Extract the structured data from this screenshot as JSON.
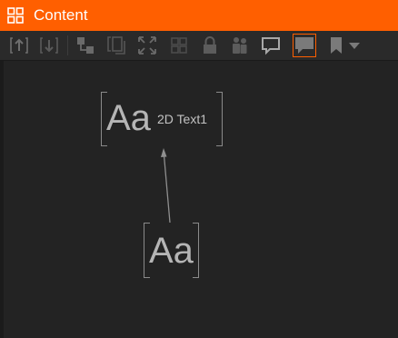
{
  "window": {
    "title": "Content",
    "accent_color": "#ff5f00"
  },
  "toolbar": {
    "buttons": [
      {
        "name": "export-button",
        "icon": "upload-icon"
      },
      {
        "name": "import-button",
        "icon": "download-icon"
      },
      {
        "name": "group-button",
        "icon": "group-nodes-icon"
      },
      {
        "name": "duplicate-button",
        "icon": "copy-icon"
      },
      {
        "name": "fit-view-button",
        "icon": "expand-icon"
      },
      {
        "name": "grid-view-button",
        "icon": "grid-icon"
      },
      {
        "name": "lock-button",
        "icon": "lock-icon"
      },
      {
        "name": "users-button",
        "icon": "users-icon"
      },
      {
        "name": "comment-button",
        "icon": "speech-bubble-icon"
      },
      {
        "name": "annotation-button",
        "icon": "speech-bubble-filled-icon",
        "active": true
      },
      {
        "name": "bookmark-button",
        "icon": "bookmark-icon"
      },
      {
        "name": "bookmark-dropdown",
        "icon": "caret-down-icon"
      }
    ]
  },
  "graph": {
    "nodes": [
      {
        "id": "text-node-1",
        "glyph": "Aa",
        "label": "2D Text1"
      },
      {
        "id": "text-node-2",
        "glyph": "Aa",
        "label": ""
      }
    ]
  }
}
